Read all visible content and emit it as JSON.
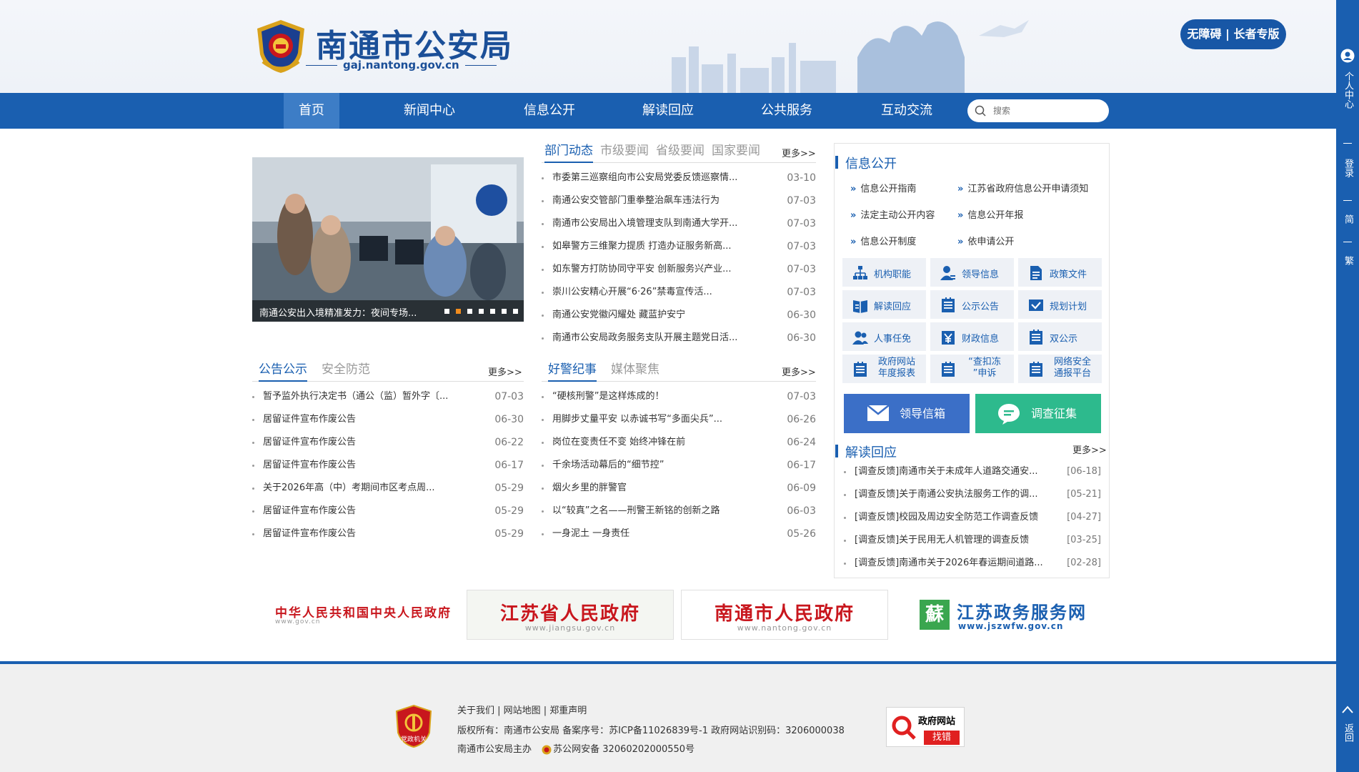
{
  "header": {
    "title": "南通市公安局",
    "domain": "gaj.nantong.gov.cn",
    "accessibility_label": "无障碍 | 长者专版"
  },
  "nav": {
    "items": [
      {
        "label": "首页",
        "active": true
      },
      {
        "label": "新闻中心"
      },
      {
        "label": "信息公开"
      },
      {
        "label": "解读回应"
      },
      {
        "label": "公共服务"
      },
      {
        "label": "互动交流"
      }
    ],
    "search_placeholder": "搜索"
  },
  "right_bar": {
    "personal_center": "个人中心",
    "login": "登录",
    "simplified": "简",
    "traditional": "繁",
    "back_top": "返回"
  },
  "carousel": {
    "caption": "南通公安出入境精准发力：夜间专场...",
    "dots": 7,
    "active_dot": 2
  },
  "news": {
    "tabs": [
      "部门动态",
      "市级要闻",
      "省级要闻",
      "国家要闻"
    ],
    "more": "更多>>",
    "items": [
      {
        "title": "市委第三巡察组向市公安局党委反馈巡察情...",
        "date": "03-10"
      },
      {
        "title": "南通公安交管部门重拳整治飙车违法行为",
        "date": "07-03"
      },
      {
        "title": "南通市公安局出入境管理支队到南通大学开...",
        "date": "07-03"
      },
      {
        "title": "如皋警方三维聚力提质 打造办证服务新高...",
        "date": "07-03"
      },
      {
        "title": "如东警方打防协同守平安 创新服务兴产业...",
        "date": "07-03"
      },
      {
        "title": "崇川公安精心开展“6·26”禁毒宣传活...",
        "date": "07-03"
      },
      {
        "title": "南通公安党徽闪耀处 藏蓝护安宁",
        "date": "06-30"
      },
      {
        "title": "南通市公安局政务服务支队开展主题党日活...",
        "date": "06-30"
      }
    ]
  },
  "notices": {
    "tabs": [
      "公告公示",
      "安全防范"
    ],
    "more": "更多>>",
    "items": [
      {
        "title": "暂予监外执行决定书（通公（监）暂外字〔...",
        "date": "07-03"
      },
      {
        "title": "居留证件宣布作废公告",
        "date": "06-30"
      },
      {
        "title": "居留证件宣布作废公告",
        "date": "06-22"
      },
      {
        "title": "居留证件宣布作废公告",
        "date": "06-17"
      },
      {
        "title": "关于2026年高（中）考期间市区考点周...",
        "date": "05-29"
      },
      {
        "title": "居留证件宣布作废公告",
        "date": "05-29"
      },
      {
        "title": "居留证件宣布作废公告",
        "date": "05-29"
      }
    ]
  },
  "heroes": {
    "tabs": [
      "好警纪事",
      "媒体聚焦"
    ],
    "more": "更多>>",
    "items": [
      {
        "title": "“硬核刑警”是这样炼成的！",
        "date": "07-03"
      },
      {
        "title": "用脚步丈量平安 以赤诚书写“多面尖兵”...",
        "date": "06-26"
      },
      {
        "title": "岗位在变责任不变 始终冲锋在前",
        "date": "06-24"
      },
      {
        "title": "千余场活动幕后的“细节控”",
        "date": "06-17"
      },
      {
        "title": "烟火乡里的胖警官",
        "date": "06-09"
      },
      {
        "title": "以“较真”之名——刑警王新铭的创新之路",
        "date": "06-03"
      },
      {
        "title": "一身泥土 一身责任",
        "date": "05-26"
      }
    ]
  },
  "info_public": {
    "heading": "信息公开",
    "links": [
      "信息公开指南",
      "江苏省政府信息公开申请须知",
      "法定主动公开内容",
      "信息公开年报",
      "信息公开制度",
      "依申请公开"
    ],
    "tiles": [
      {
        "label": "机构职能",
        "icon": "org-chart-icon"
      },
      {
        "label": "领导信息",
        "icon": "user-icon"
      },
      {
        "label": "政策文件",
        "icon": "document-icon"
      },
      {
        "label": "解读回应",
        "icon": "book-icon"
      },
      {
        "label": "公示公告",
        "icon": "list-icon"
      },
      {
        "label": "规划计划",
        "icon": "mail-check-icon"
      },
      {
        "label": "人事任免",
        "icon": "people-icon"
      },
      {
        "label": "财政信息",
        "icon": "yuan-icon"
      },
      {
        "label": "双公示",
        "icon": "list-icon"
      },
      {
        "label": "政府网站年度报表",
        "icon": "list-icon"
      },
      {
        "label": "“查扣冻”申诉",
        "icon": "list-icon"
      },
      {
        "label": "网络安全通报平台",
        "icon": "list-icon"
      }
    ],
    "mailbox_label": "领导信箱",
    "survey_label": "调查征集",
    "mailbox_color": "#3b6fc7",
    "survey_color": "#2dba8d"
  },
  "replies": {
    "heading": "解读回应",
    "more": "更多>>",
    "items": [
      {
        "title": "[调查反馈]南通市关于未成年人道路交通安...",
        "date": "[06-18]"
      },
      {
        "title": "[调查反馈]关于南通公安执法服务工作的调...",
        "date": "[05-21]"
      },
      {
        "title": "[调查反馈]校园及周边安全防范工作调查反馈",
        "date": "[04-27]"
      },
      {
        "title": "[调查反馈]关于民用无人机管理的调查反馈",
        "date": "[03-25]"
      },
      {
        "title": "[调查反馈]南通市关于2026年春运期间道路...",
        "date": "[02-28]"
      }
    ]
  },
  "banners": [
    {
      "main": "中华人民共和国中央人民政府",
      "sub": "www.gov.cn",
      "color": "#c8161d"
    },
    {
      "main": "江苏省人民政府",
      "sub": "www.jiangsu.gov.cn",
      "color": "#c8161d"
    },
    {
      "main": "南通市人民政府",
      "sub": "www.nantong.gov.cn",
      "color": "#c8161d"
    },
    {
      "main": "江苏政务服务网",
      "sub": "www.jszwfw.gov.cn",
      "color": "#1a5fb0",
      "logo_char": "蘇"
    }
  ],
  "footer": {
    "links": "关于我们 | 网站地图 | 郑重声明",
    "copyright": "版权所有：南通市公安局   备案序号：苏ICP备11026839号-1    政府网站识别码：3206000038",
    "host": "南通市公安局主办",
    "police_record": "苏公网安备 32060202000550号",
    "gov_error_line1": "政府网站",
    "gov_error_line2": "找错",
    "emblem_label": "党政机关"
  }
}
